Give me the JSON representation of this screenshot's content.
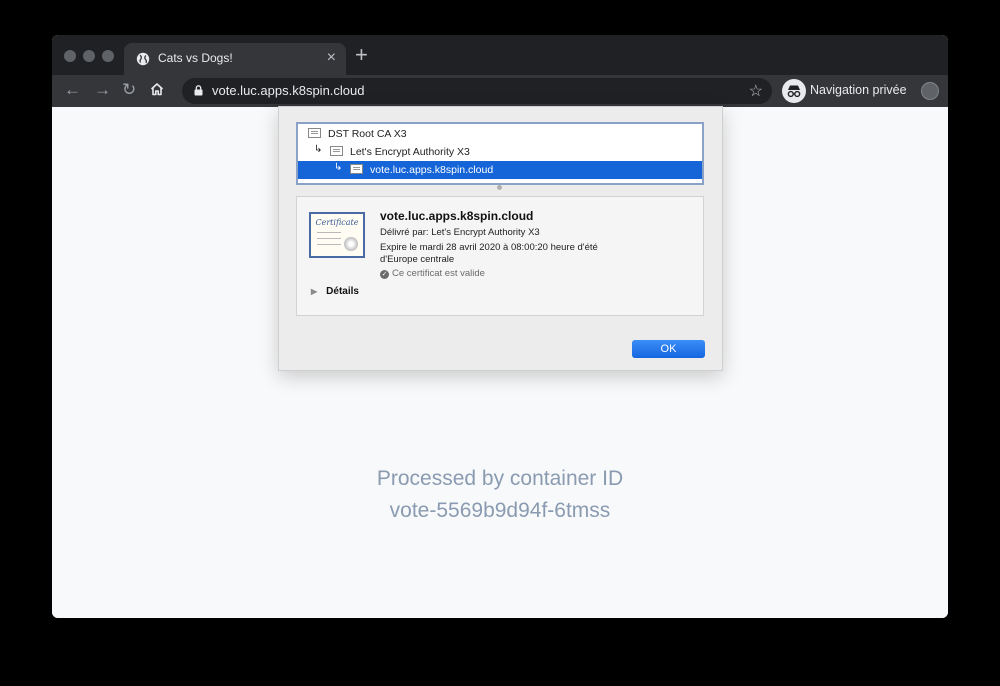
{
  "browser": {
    "tab": {
      "title": "Cats vs Dogs!",
      "icon": "globe-icon"
    },
    "address_bar": {
      "url": "vote.luc.apps.k8spin.cloud"
    },
    "profile": {
      "label": "Navigation privée",
      "icon": "incognito-icon"
    }
  },
  "certificate_dialog": {
    "chain": [
      {
        "label": "DST Root CA X3"
      },
      {
        "label": "Let's Encrypt Authority X3"
      },
      {
        "label": "vote.luc.apps.k8spin.cloud",
        "selected": true
      }
    ],
    "certificate": {
      "image_text": "Certificate",
      "common_name": "vote.luc.apps.k8spin.cloud",
      "issuer": "Délivré par: Let's Encrypt Authority X3",
      "expiry_line1": "Expire le mardi 28 avril 2020 à 08:00:20 heure d'été",
      "expiry_line2": "d'Europe centrale",
      "status": "Ce certificat est valide"
    },
    "details_label": "Détails",
    "ok_label": "OK"
  },
  "page": {
    "processed_line1": "Processed by container ID",
    "processed_line2": "vote-5569b9d94f-6tmss"
  },
  "colors": {
    "selection": "#1565d8",
    "text_muted": "#8a9bb1",
    "toolbar": "#35363a"
  }
}
